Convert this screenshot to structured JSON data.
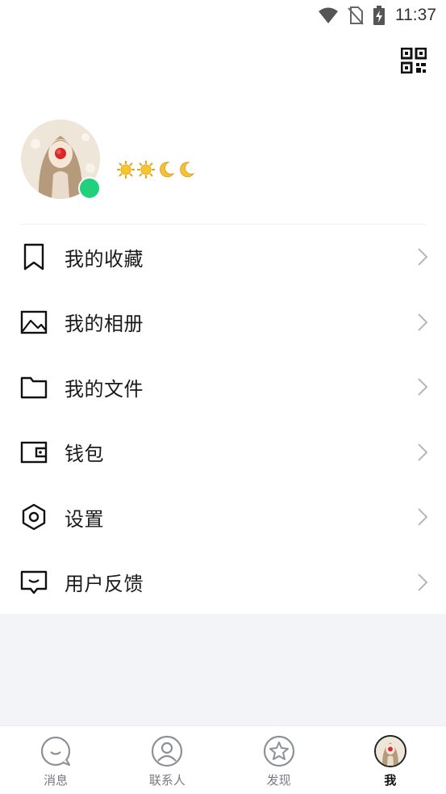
{
  "status_bar": {
    "time": "11:37",
    "icons": [
      "wifi-icon",
      "no-sim-icon",
      "battery-charging-icon"
    ]
  },
  "header": {
    "qr_icon": "qr-code-icon"
  },
  "profile": {
    "online_status_color": "#1fd17c",
    "level_icons": [
      "sun-icon",
      "sun-icon",
      "moon-icon",
      "moon-icon"
    ]
  },
  "menu": {
    "items": [
      {
        "label": "我的收藏",
        "icon": "bookmark-icon"
      },
      {
        "label": "我的相册",
        "icon": "image-icon"
      },
      {
        "label": "我的文件",
        "icon": "folder-icon"
      },
      {
        "label": "钱包",
        "icon": "wallet-icon"
      },
      {
        "label": "设置",
        "icon": "settings-icon"
      },
      {
        "label": "用户反馈",
        "icon": "feedback-icon"
      }
    ]
  },
  "tabs": [
    {
      "label": "消息",
      "icon": "message-icon",
      "active": false
    },
    {
      "label": "联系人",
      "icon": "contacts-icon",
      "active": false
    },
    {
      "label": "发现",
      "icon": "discover-icon",
      "active": false
    },
    {
      "label": "我",
      "icon": "avatar",
      "active": true
    }
  ],
  "colors": {
    "accent_online": "#1fd17c",
    "background_gray": "#f3f4f8",
    "tab_inactive": "#777a80",
    "tab_active": "#111111"
  }
}
